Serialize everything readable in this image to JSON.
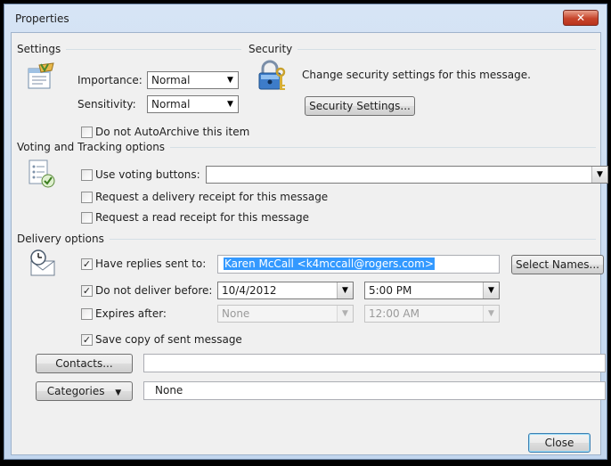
{
  "window": {
    "title": "Properties",
    "close_glyph": "✕"
  },
  "settings": {
    "header": "Settings",
    "importance_label": "Importance:",
    "importance_value": "Normal",
    "sensitivity_label": "Sensitivity:",
    "sensitivity_value": "Normal",
    "autoarchive_label": "Do not AutoArchive this item",
    "autoarchive_checked": false,
    "icon": "message-settings-icon"
  },
  "security": {
    "header": "Security",
    "description": "Change security settings for this message.",
    "button_label": "Security Settings...",
    "icon": "padlock-key-icon"
  },
  "voting": {
    "header": "Voting and Tracking options",
    "use_voting_label": "Use voting buttons:",
    "use_voting_checked": false,
    "voting_value": "",
    "delivery_receipt_label": "Request a delivery receipt for this message",
    "delivery_receipt_checked": false,
    "read_receipt_label": "Request a read receipt for this message",
    "read_receipt_checked": false,
    "icon": "tracking-checkmark-icon"
  },
  "delivery": {
    "header": "Delivery options",
    "replies_label": "Have replies sent to:",
    "replies_checked": true,
    "replies_value": "Karen McCall <k4mccall@rogers.com>",
    "select_names_label": "Select Names...",
    "not_before_label": "Do not deliver before:",
    "not_before_checked": true,
    "not_before_date": "10/4/2012",
    "not_before_time": "5:00 PM",
    "expires_label": "Expires after:",
    "expires_checked": false,
    "expires_date": "None",
    "expires_time": "12:00 AM",
    "save_copy_label": "Save copy of sent message",
    "save_copy_checked": true,
    "icon": "delivery-clock-icon"
  },
  "contacts": {
    "button_label": "Contacts...",
    "value": ""
  },
  "categories": {
    "button_label": "Categories",
    "value": "None"
  },
  "footer": {
    "close_label": "Close"
  },
  "colors": {
    "selection": "#3399ff",
    "title_close": "#c7452c"
  }
}
